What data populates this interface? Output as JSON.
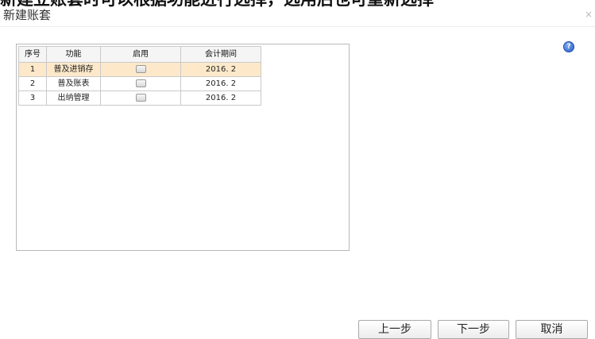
{
  "banner": {
    "text": "新建立账套时可以根据功能进行选择，选用后也可重新选择"
  },
  "dialog": {
    "title": "新建账套",
    "close_glyph": "×",
    "help_glyph": "?"
  },
  "grid": {
    "headers": [
      "序号",
      "功能",
      "启用",
      "会计期间"
    ],
    "rows": [
      {
        "no": "1",
        "func": "普及进销存",
        "enabled": false,
        "period": "2016. 2"
      },
      {
        "no": "2",
        "func": "普及账表",
        "enabled": false,
        "period": "2016. 2"
      },
      {
        "no": "3",
        "func": "出纳管理",
        "enabled": false,
        "period": "2016. 2"
      }
    ]
  },
  "buttons": {
    "prev": "上一步",
    "next": "下一步",
    "cancel": "取消"
  },
  "colors": {
    "selected_row": "#fde9c9",
    "help_icon": "#2a5fc9"
  }
}
